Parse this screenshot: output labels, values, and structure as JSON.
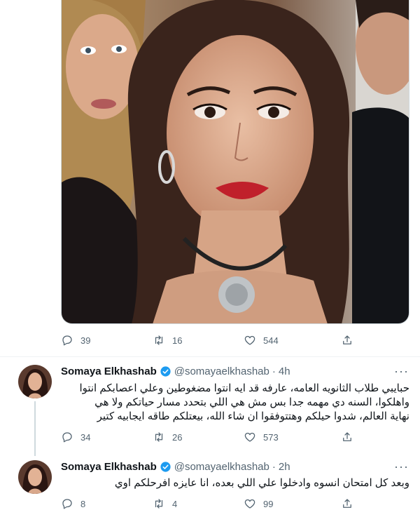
{
  "colors": {
    "accent": "#1d9bf0",
    "muted": "#536471",
    "text": "#0f1419",
    "border": "#eff3f4"
  },
  "top_tweet": {
    "image_alt": "photo",
    "actions": {
      "replies": "39",
      "retweets": "16",
      "likes": "544"
    }
  },
  "tweets": [
    {
      "name": "Somaya Elkhashab",
      "handle": "@somayaelkhashab",
      "dot": "·",
      "time": "4h",
      "more": "···",
      "lines": [
        "حبايبي طلاب الثانويه العامه، عارفه قد ايه انتوا مضغوطين وعلي اعصابكم انتوا",
        "واهلكوا، السنه دي مهمه جدا بس مش هي اللي بتحدد مسار حياتكم ولا هي",
        "نهاية العالم، شدوا حيلكم وهتتوفقوا ان شاء الله، بيعتلكم طاقه ايجابيه كتير"
      ],
      "actions": {
        "replies": "34",
        "retweets": "26",
        "likes": "573"
      }
    },
    {
      "name": "Somaya Elkhashab",
      "handle": "@somayaelkhashab",
      "dot": "·",
      "time": "2h",
      "more": "···",
      "lines": [
        "وبعد كل امتحان انسوه وادخلوا علي اللي بعده، انا عايزه افرحلكم اوي"
      ],
      "actions": {
        "replies": "8",
        "retweets": "4",
        "likes": "99"
      }
    }
  ],
  "icons": [
    "reply-icon",
    "retweet-icon",
    "like-icon",
    "share-icon",
    "verified-icon",
    "more-icon"
  ]
}
